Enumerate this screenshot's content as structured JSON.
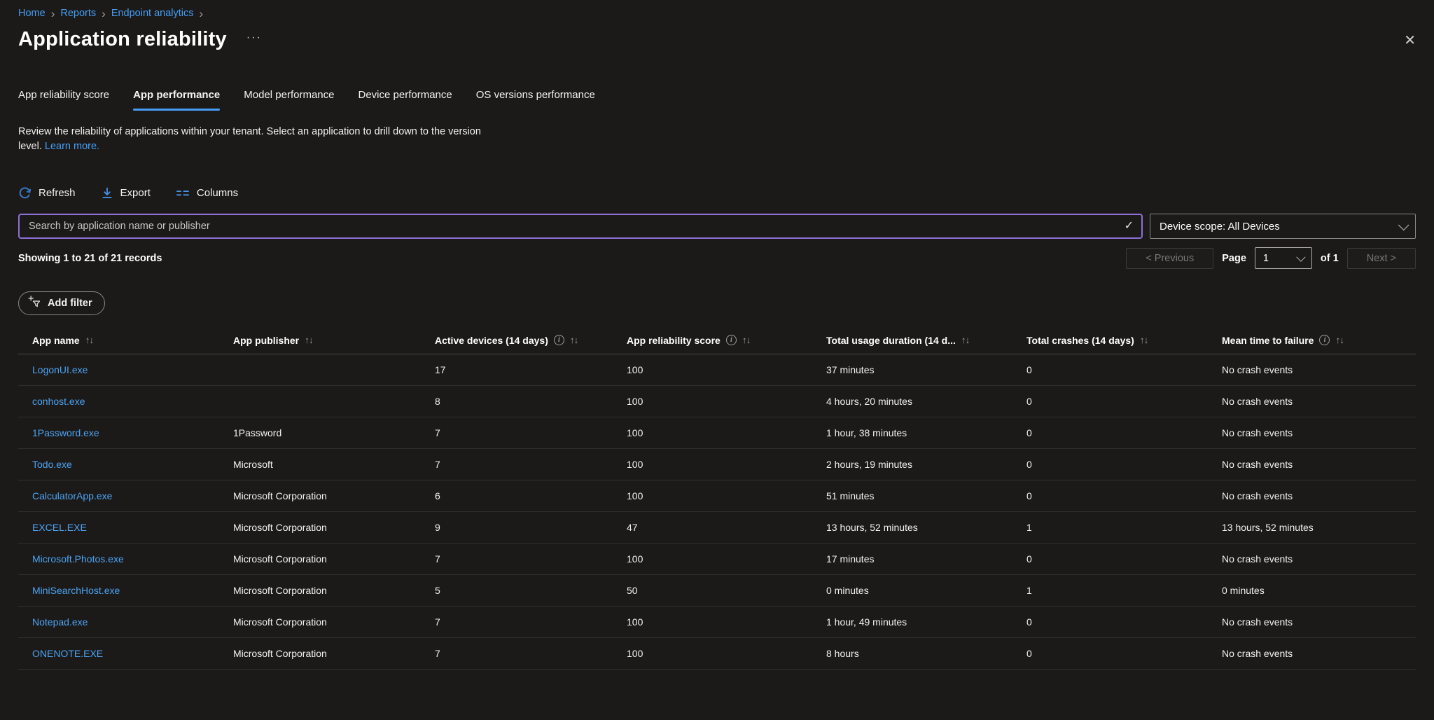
{
  "colors": {
    "accent_blue": "#479ef5",
    "link_blue": "#4da3f2",
    "search_border_purple": "#8f6fd6",
    "background": "#1b1a19"
  },
  "icons": {
    "check": "✓",
    "close": "✕",
    "more": "···",
    "breadcrumb_sep": "›"
  },
  "breadcrumb": {
    "items": [
      {
        "label": "Home"
      },
      {
        "label": "Reports"
      },
      {
        "label": "Endpoint analytics"
      }
    ]
  },
  "page": {
    "title": "Application reliability"
  },
  "tabs": {
    "items": [
      {
        "label": "App reliability score",
        "active": false
      },
      {
        "label": "App performance",
        "active": true
      },
      {
        "label": "Model performance",
        "active": false
      },
      {
        "label": "Device performance",
        "active": false
      },
      {
        "label": "OS versions performance",
        "active": false
      }
    ]
  },
  "description": {
    "text": "Review the reliability of applications within your tenant. Select an application to drill down to the version level. ",
    "link_label": "Learn more."
  },
  "toolbar": {
    "refresh_label": "Refresh",
    "export_label": "Export",
    "columns_label": "Columns"
  },
  "search": {
    "placeholder": "Search by application name or publisher"
  },
  "device_scope": {
    "value": "Device scope: All Devices"
  },
  "records": {
    "summary": "Showing 1 to 21 of 21 records"
  },
  "pagination": {
    "previous_label": "< Previous",
    "page_label": "Page",
    "page_value": "1",
    "of_label": "of 1",
    "next_label": "Next >"
  },
  "filters": {
    "add_label": "Add filter"
  },
  "table": {
    "sort_glyph": "↑↓",
    "columns": [
      {
        "label": "App name",
        "info": false
      },
      {
        "label": "App publisher",
        "info": false
      },
      {
        "label": "Active devices (14 days)",
        "info": true
      },
      {
        "label": "App reliability score",
        "info": true
      },
      {
        "label": "Total usage duration (14 d...",
        "info": false
      },
      {
        "label": "Total crashes (14 days)",
        "info": false
      },
      {
        "label": "Mean time to failure",
        "info": true
      }
    ],
    "rows": [
      {
        "name": "LogonUI.exe",
        "publisher": "",
        "devices": "17",
        "score": "100",
        "duration": "37 minutes",
        "crashes": "0",
        "mttf": "No crash events"
      },
      {
        "name": "conhost.exe",
        "publisher": "",
        "devices": "8",
        "score": "100",
        "duration": "4 hours, 20 minutes",
        "crashes": "0",
        "mttf": "No crash events"
      },
      {
        "name": "1Password.exe",
        "publisher": "1Password",
        "devices": "7",
        "score": "100",
        "duration": "1 hour, 38 minutes",
        "crashes": "0",
        "mttf": "No crash events"
      },
      {
        "name": "Todo.exe",
        "publisher": "Microsoft",
        "devices": "7",
        "score": "100",
        "duration": "2 hours, 19 minutes",
        "crashes": "0",
        "mttf": "No crash events"
      },
      {
        "name": "CalculatorApp.exe",
        "publisher": "Microsoft Corporation",
        "devices": "6",
        "score": "100",
        "duration": "51 minutes",
        "crashes": "0",
        "mttf": "No crash events"
      },
      {
        "name": "EXCEL.EXE",
        "publisher": "Microsoft Corporation",
        "devices": "9",
        "score": "47",
        "duration": "13 hours, 52 minutes",
        "crashes": "1",
        "mttf": "13 hours, 52 minutes"
      },
      {
        "name": "Microsoft.Photos.exe",
        "publisher": "Microsoft Corporation",
        "devices": "7",
        "score": "100",
        "duration": "17 minutes",
        "crashes": "0",
        "mttf": "No crash events"
      },
      {
        "name": "MiniSearchHost.exe",
        "publisher": "Microsoft Corporation",
        "devices": "5",
        "score": "50",
        "duration": "0 minutes",
        "crashes": "1",
        "mttf": "0 minutes"
      },
      {
        "name": "Notepad.exe",
        "publisher": "Microsoft Corporation",
        "devices": "7",
        "score": "100",
        "duration": "1 hour, 49 minutes",
        "crashes": "0",
        "mttf": "No crash events"
      },
      {
        "name": "ONENOTE.EXE",
        "publisher": "Microsoft Corporation",
        "devices": "7",
        "score": "100",
        "duration": "8 hours",
        "crashes": "0",
        "mttf": "No crash events"
      }
    ]
  }
}
